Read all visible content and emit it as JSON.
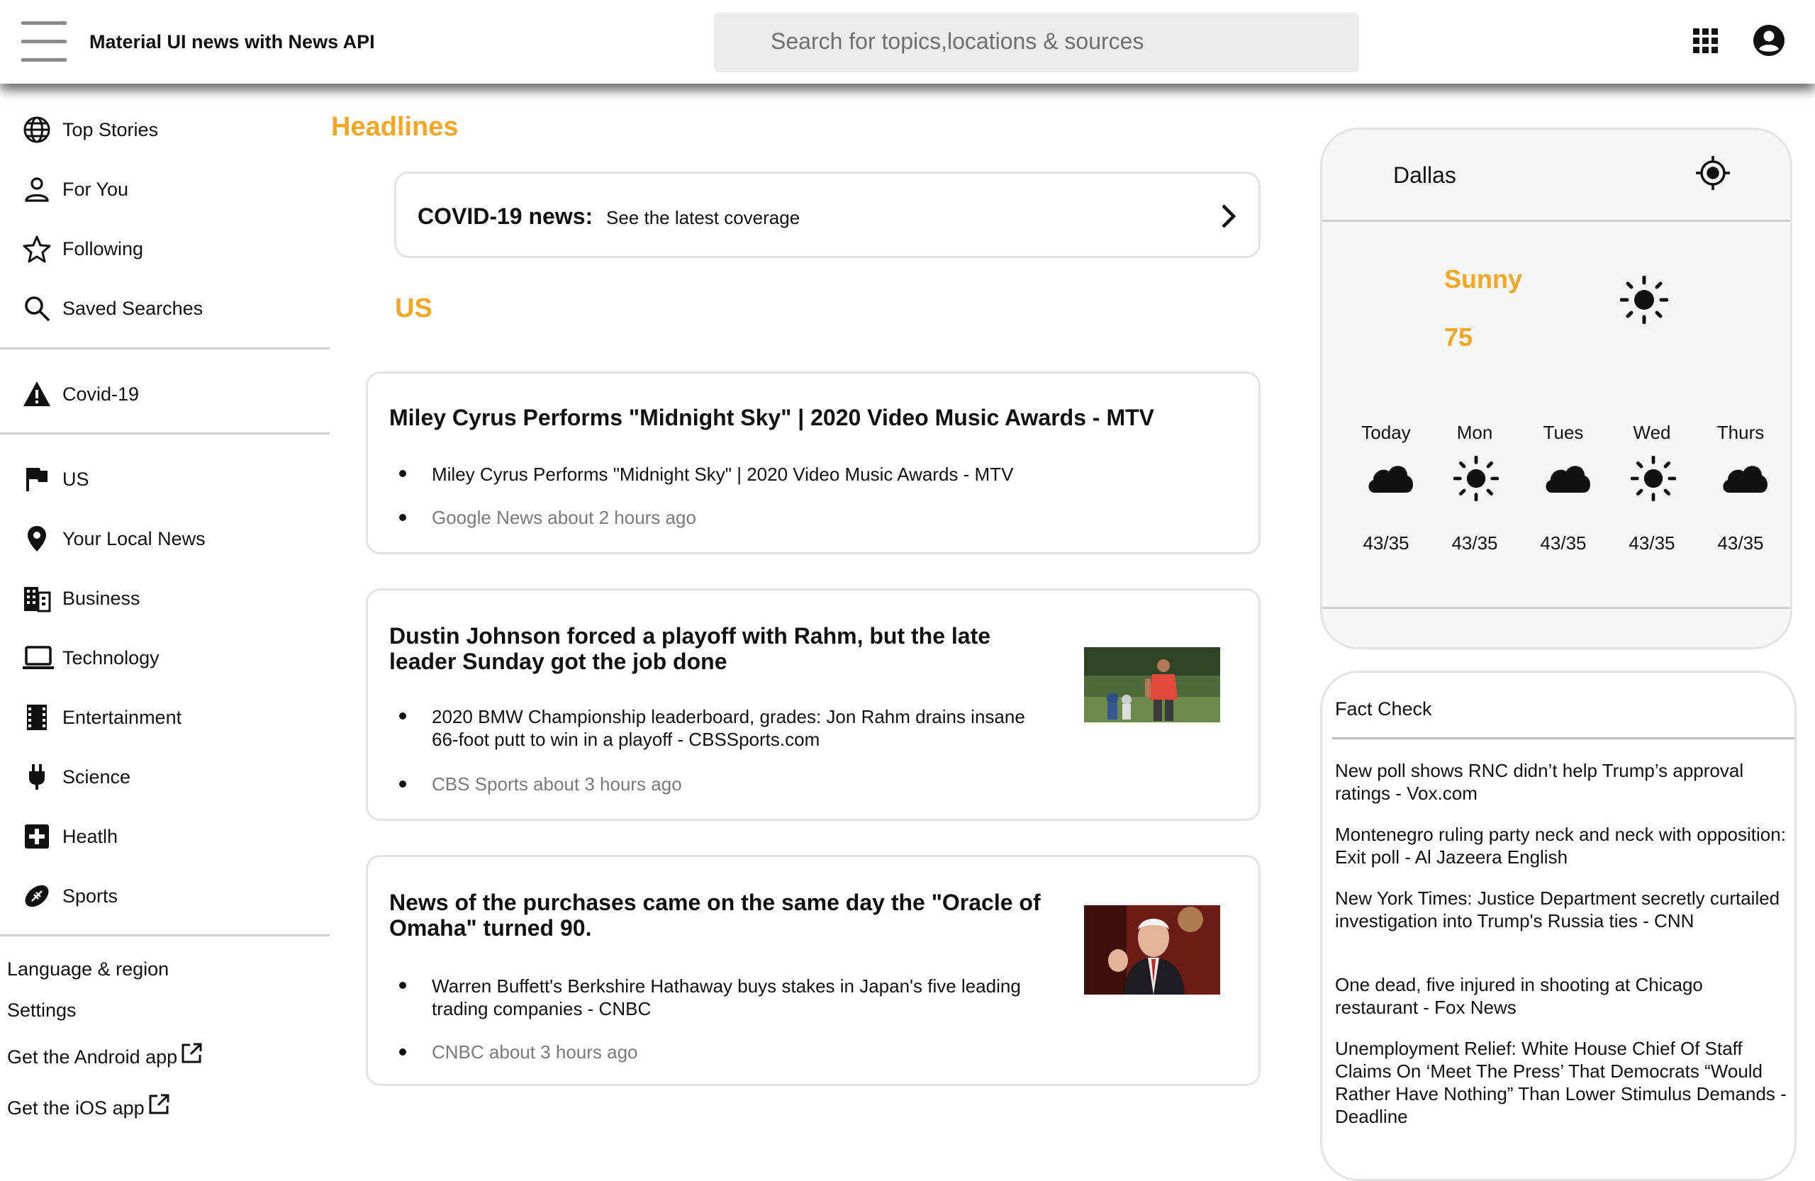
{
  "app": {
    "title": "Material UI news with News API"
  },
  "search": {
    "placeholder": "Search for topics,locations & sources"
  },
  "sidebar": {
    "primary": [
      {
        "label": "Top Stories",
        "icon": "globe-icon"
      },
      {
        "label": "For You",
        "icon": "person-icon"
      },
      {
        "label": "Following",
        "icon": "star-icon"
      },
      {
        "label": "Saved Searches",
        "icon": "search-icon"
      }
    ],
    "covid": {
      "label": "Covid-19",
      "icon": "warning-icon"
    },
    "topics": [
      {
        "label": "US",
        "icon": "flag-icon"
      },
      {
        "label": "Your Local News",
        "icon": "location-pin-icon"
      },
      {
        "label": "Business",
        "icon": "building-icon"
      },
      {
        "label": "Technology",
        "icon": "laptop-icon"
      },
      {
        "label": "Entertainment",
        "icon": "film-icon"
      },
      {
        "label": "Science",
        "icon": "plug-icon"
      },
      {
        "label": "Heatlh",
        "icon": "medical-cross-icon"
      },
      {
        "label": "Sports",
        "icon": "football-icon"
      }
    ],
    "links": {
      "language": "Language & region",
      "settings": "Settings",
      "android": "Get the Android app",
      "ios": "Get the iOS app"
    }
  },
  "main": {
    "headlines": "Headlines",
    "covid_card": {
      "title": "COVID-19 news:",
      "subtitle": "See the latest coverage"
    },
    "section": "US",
    "articles": [
      {
        "title": "Miley Cyrus Performs \"Midnight Sky\" | 2020 Video Music Awards - MTV",
        "subtitle": "Miley Cyrus Performs \"Midnight Sky\" | 2020 Video Music Awards - MTV",
        "source": "Google News about 2 hours ago"
      },
      {
        "title": "Dustin Johnson forced a playoff with Rahm, but the late leader Sunday got the job done",
        "subtitle": "2020 BMW Championship leaderboard, grades: Jon Rahm drains insane 66-foot putt to win in a playoff - CBSSports.com",
        "source": "CBS Sports about 3 hours ago"
      },
      {
        "title": "News of the purchases came on the same day the \"Oracle of Omaha\" turned 90.",
        "subtitle": "Warren Buffett's Berkshire Hathaway buys stakes in Japan's five leading trading companies - CNBC",
        "source": "CNBC about 3 hours ago"
      }
    ]
  },
  "weather": {
    "city": "Dallas",
    "condition": "Sunny",
    "temp": "75",
    "forecast": [
      {
        "day": "Today",
        "icon": "cloud-icon",
        "temps": "43/35"
      },
      {
        "day": "Mon",
        "icon": "sun-icon",
        "temps": "43/35"
      },
      {
        "day": "Tues",
        "icon": "cloud-icon",
        "temps": "43/35"
      },
      {
        "day": "Wed",
        "icon": "sun-icon",
        "temps": "43/35"
      },
      {
        "day": "Thurs",
        "icon": "cloud-icon",
        "temps": "43/35"
      }
    ]
  },
  "fact_check": {
    "title": "Fact Check",
    "items": [
      "New poll shows RNC didn’t help Trump’s approval ratings - Vox.com",
      "Montenegro ruling party neck and neck with opposition: Exit poll - Al Jazeera English",
      "New York Times: Justice Department secretly curtailed investigation into Trump's Russia ties - CNN",
      "One dead, five injured in shooting at Chicago restaurant - Fox News",
      "Unemployment Relief: White House Chief Of Staff Claims On ‘Meet The Press’ That Democrats “Would Rather Have Nothing” Than Lower Stimulus Demands - Deadline"
    ]
  },
  "colors": {
    "accent": "#f5a623",
    "card_border": "#e3e3e3",
    "muted_text": "#7a7a7a"
  }
}
